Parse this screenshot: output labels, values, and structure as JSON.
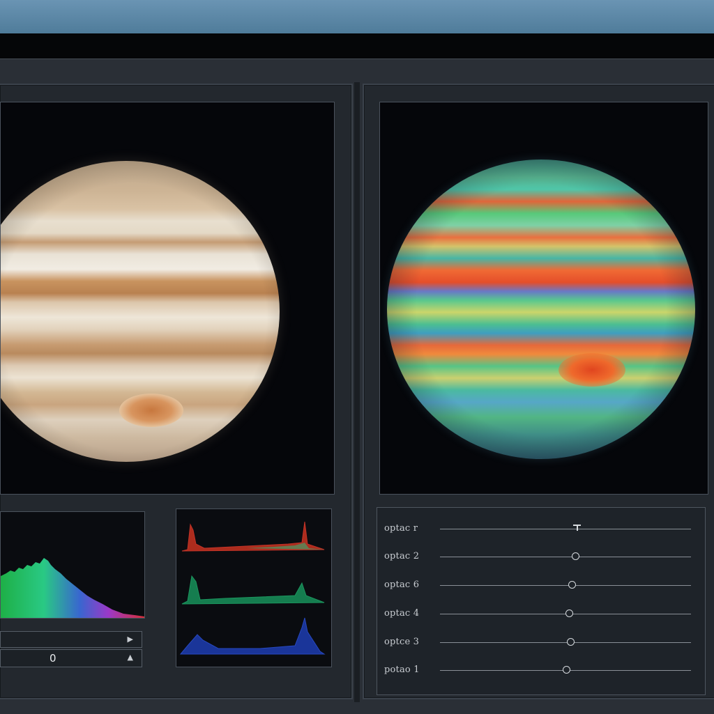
{
  "views": {
    "original": {
      "icon": "planet-true-color"
    },
    "false_color": {
      "icon": "planet-false-color"
    }
  },
  "histogram": {
    "icon": "luminance-histogram",
    "colors": [
      "#1fb84a",
      "#2bd38a",
      "#3b6bd9",
      "#a23bd2",
      "#e0303a"
    ]
  },
  "rgb_histograms": {
    "channels": [
      {
        "name": "red",
        "color": "#e33a2c"
      },
      {
        "name": "green",
        "color": "#1fae6c"
      },
      {
        "name": "blue",
        "color": "#2a4fd3"
      }
    ]
  },
  "controls": {
    "field_1_arrow": "▶",
    "field_2_value": "0",
    "field_2_arrow": "▲"
  },
  "sliders": [
    {
      "label": "optac r",
      "value": 0.52,
      "knob": "tee"
    },
    {
      "label": "optac 2",
      "value": 0.53,
      "knob": "circle"
    },
    {
      "label": "optac 6",
      "value": 0.52,
      "knob": "circle"
    },
    {
      "label": "optac 4",
      "value": 0.51,
      "knob": "circle"
    },
    {
      "label": "optce 3",
      "value": 0.52,
      "knob": "circle"
    },
    {
      "label": "potao 1",
      "value": 0.51,
      "knob": "circle"
    }
  ]
}
